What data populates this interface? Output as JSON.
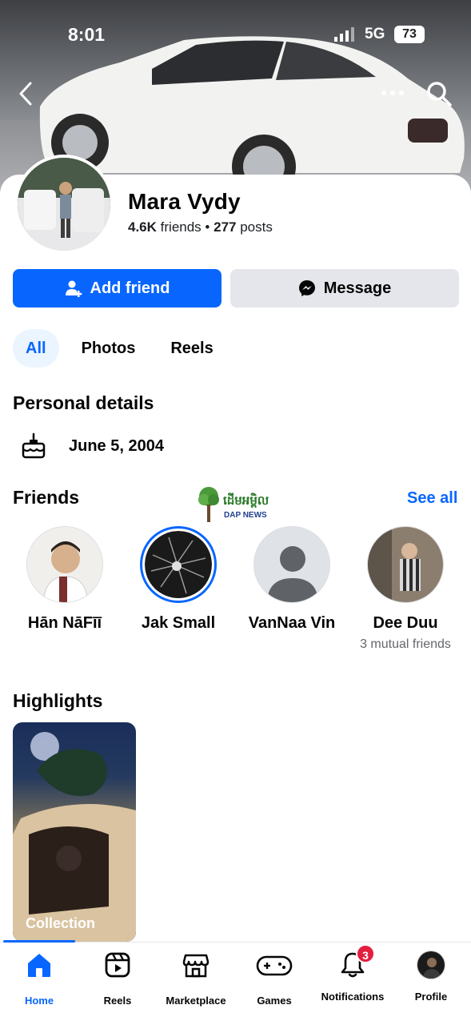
{
  "status_bar": {
    "time": "8:01",
    "network": "5G",
    "battery": "73"
  },
  "profile": {
    "name": "Mara Vydy",
    "friends_count": "4.6K",
    "friends_label": "friends",
    "separator": "•",
    "posts_count": "277",
    "posts_label": "posts"
  },
  "actions": {
    "add_friend": "Add friend",
    "message": "Message"
  },
  "tabs": [
    {
      "label": "All",
      "active": true
    },
    {
      "label": "Photos",
      "active": false
    },
    {
      "label": "Reels",
      "active": false
    }
  ],
  "personal_details": {
    "title": "Personal details",
    "birthday": "June 5, 2004"
  },
  "friends_section": {
    "title": "Friends",
    "see_all": "See all",
    "items": [
      {
        "name": "Hān NāFīī",
        "sub": ""
      },
      {
        "name": "Jak Small",
        "sub": ""
      },
      {
        "name": "VanNaa Vin",
        "sub": ""
      },
      {
        "name": "Dee Duu",
        "sub": "3 mutual friends"
      }
    ]
  },
  "watermark": {
    "text": "ដើមអម្ពិល",
    "sub": "DAP NEWS"
  },
  "highlights": {
    "title": "Highlights",
    "items": [
      {
        "label": "Collection"
      }
    ]
  },
  "bottom_nav": {
    "items": [
      {
        "label": "Home",
        "icon": "home-icon",
        "active": true
      },
      {
        "label": "Reels",
        "icon": "reels-icon",
        "active": false
      },
      {
        "label": "Marketplace",
        "icon": "marketplace-icon",
        "active": false
      },
      {
        "label": "Games",
        "icon": "games-icon",
        "active": false
      },
      {
        "label": "Notifications",
        "icon": "bell-icon",
        "active": false,
        "badge": "3"
      },
      {
        "label": "Profile",
        "icon": "profile-avatar",
        "active": false
      }
    ]
  },
  "colors": {
    "accent": "#0866ff",
    "badge": "#e41e3f",
    "secondary_button": "#e4e6eb",
    "tab_active_bg": "#ebf5ff"
  }
}
